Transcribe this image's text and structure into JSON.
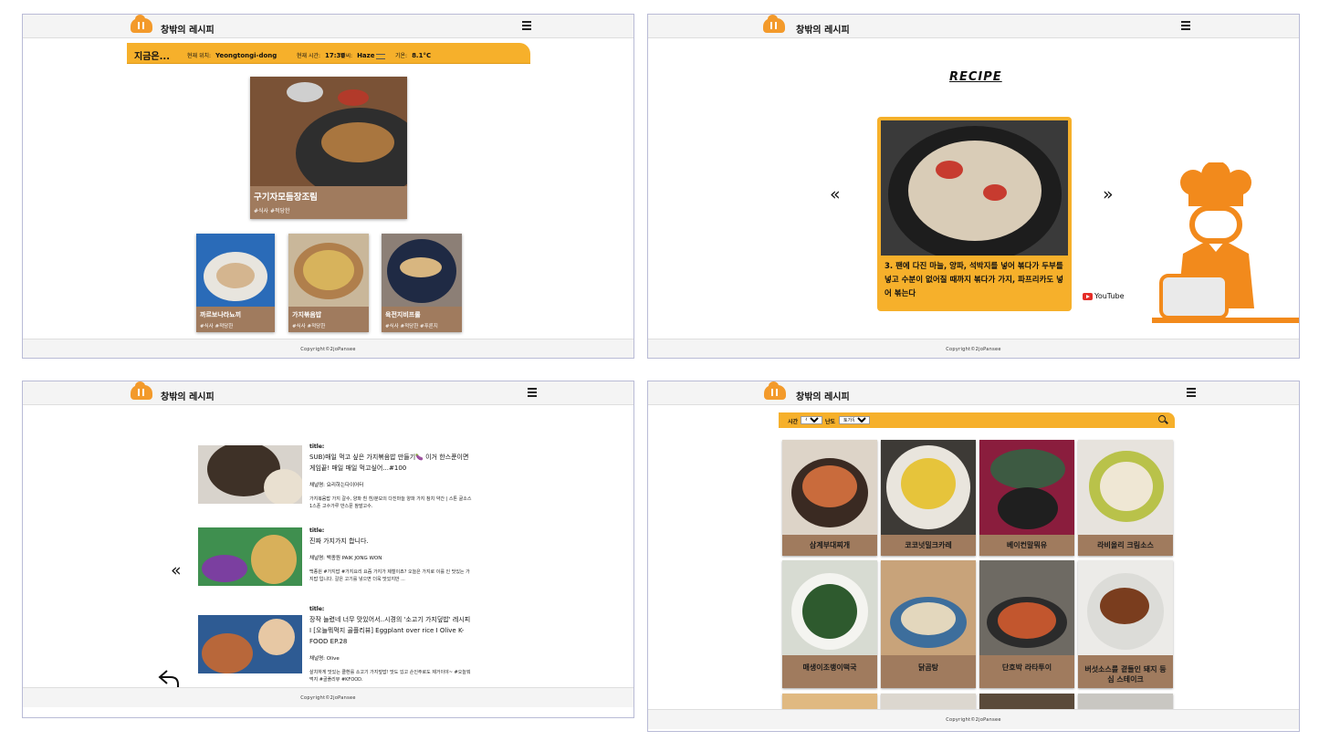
{
  "header": {
    "brand": "창밖의 레시피",
    "menu_icon": "hamburger-icon",
    "logo_icon": "cloud-utensils-icon"
  },
  "footer": {
    "copyright": "Copyright©2joPansee"
  },
  "colors": {
    "accent": "#f6b02b",
    "card": "#a07b5e",
    "chef": "#f28a1c"
  },
  "home": {
    "weather": {
      "heading": "지금은...",
      "location_label": "현재 위치:",
      "location_value": "Yeongtongi-dong",
      "time_label": "현재 시간:",
      "time_value": "17:38",
      "weather_label": "날씨:",
      "weather_value": "Haze",
      "temp_label": "기온:",
      "temp_value": "8.1°C"
    },
    "featured": {
      "title": "구기자모듬장조림",
      "tags": "#식사 #적당한"
    },
    "small_cards": [
      {
        "title": "까르보나라뇨끼",
        "tags": "#식사 #적당한"
      },
      {
        "title": "가지볶음밥",
        "tags": "#식사 #적당한"
      },
      {
        "title": "육전지비프롤",
        "tags": "#식사 #적당한 #푸른지"
      }
    ]
  },
  "recipe": {
    "heading": "RECIPE",
    "prev": "«",
    "next": "»",
    "step_text": "3. 팬에 다진 마늘, 양파, 석박지를 넣어 볶다가 두부를 넣고 수분이 없어질 때까지 볶다가 가지, 파프리카도 넣어 볶는다",
    "youtube_label": "YouTube"
  },
  "videos": {
    "prev": "«",
    "back_icon": "return-arrow-icon",
    "items": [
      {
        "title_label": "title:",
        "title": "SUB)매일 먹고 싶은 가지볶음밥 만들기🍆 이거 한스푼이면 게임끝! 매일 매일 먹고싶어...#100",
        "channel": "채널명: 요리하는다이어터",
        "desc": "가지볶음밥 가지 갈수, 양파 흰 흰/분모의 다진마늘 양파 가지 참치 약간 | 스톤 굴소스 1스푼 고수가루 반스푼 참발고수."
      },
      {
        "title_label": "title:",
        "title": "진짜 가지가지 합니다.",
        "channel": "채널명: 백종원 PAIK JONG WON",
        "desc": "백종원 #가지밥 #가지요리 요즘 가지가 제철이죠? 오늘은 가지로 이를 인 맛있는 가지밥 입니다. 갈은 고기를 넣으면 더욱 맛있지만 ..."
      },
      {
        "title_label": "title:",
        "title": "장작 늘렸네 너무 맛있어서..시경의 '소고기 가지덮밥' 레시피 I [오늘뭐먹지 골플리뷰] Eggplant over rice I Olive K-FOOD EP.28",
        "channel": "채널명: Olive",
        "desc": "살치하게 맛있는 클환를 소고기 가지덮밥! 맛도 있고 손인주로도 제거이야~ #오늘뭐먹지 #골플리뷰 #KFOOD."
      }
    ]
  },
  "gallery": {
    "filter_time_label": "시간",
    "filter_time_value": "식사",
    "filter_level_label": "난도",
    "filter_level_value": "토가우 음식",
    "search_icon": "search-icon",
    "items": [
      "삼계부대찌개",
      "코코넛밀크카레",
      "베이컨말뭐유",
      "라비올리 크림소스",
      "매생이조랭이떡국",
      "닭곰탕",
      "단호박 라타투이",
      "버섯소스를 곁들인 돼지 등심 스테이크"
    ]
  }
}
